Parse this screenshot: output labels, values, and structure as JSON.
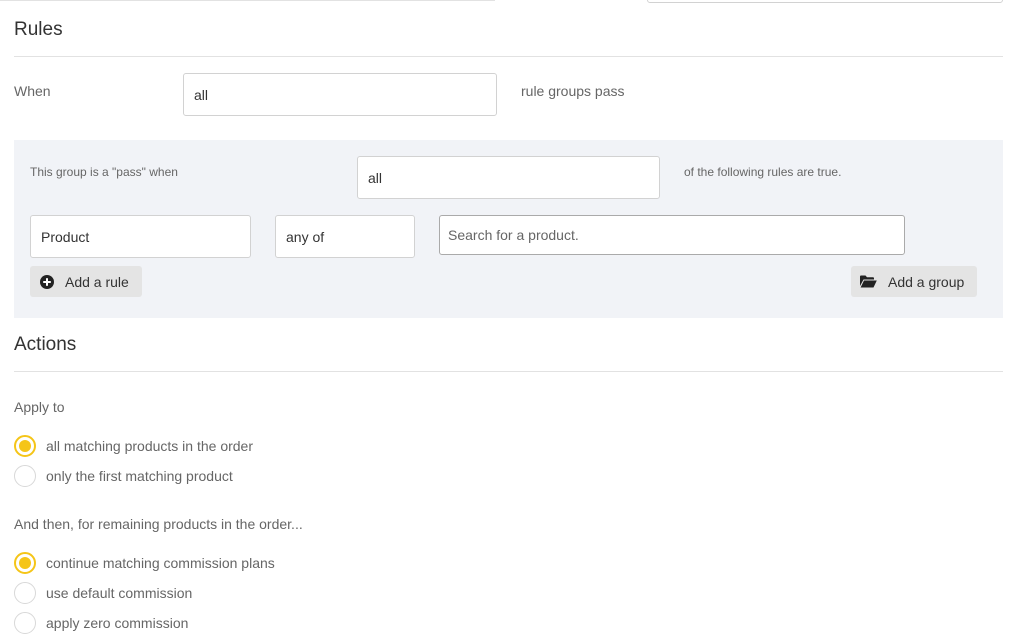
{
  "rules": {
    "title": "Rules",
    "when_label": "When",
    "when_value": "all",
    "when_suffix": "rule groups pass",
    "group": {
      "pass_label": "This group is a \"pass\" when",
      "pass_value": "all",
      "pass_suffix": "of the following rules are true.",
      "rule": {
        "field": "Product",
        "operator": "any of",
        "search_placeholder": "Search for a product."
      },
      "add_rule_label": "Add a rule",
      "add_group_label": "Add a group"
    }
  },
  "actions": {
    "title": "Actions",
    "apply_to_label": "Apply to",
    "apply_to_options": [
      {
        "label": "all matching products in the order",
        "checked": true
      },
      {
        "label": "only the first matching product",
        "checked": false
      }
    ],
    "remaining_label": "And then, for remaining products in the order...",
    "remaining_options": [
      {
        "label": "continue matching commission plans",
        "checked": true
      },
      {
        "label": "use default commission",
        "checked": false
      },
      {
        "label": "apply zero commission",
        "checked": false
      }
    ]
  },
  "colors": {
    "accent": "#f5c518",
    "panel_bg": "#f1f3f7",
    "button_bg": "#e4e4e4"
  },
  "icons": {
    "add_rule": "plus-circle-icon",
    "add_group": "folder-open-icon"
  }
}
